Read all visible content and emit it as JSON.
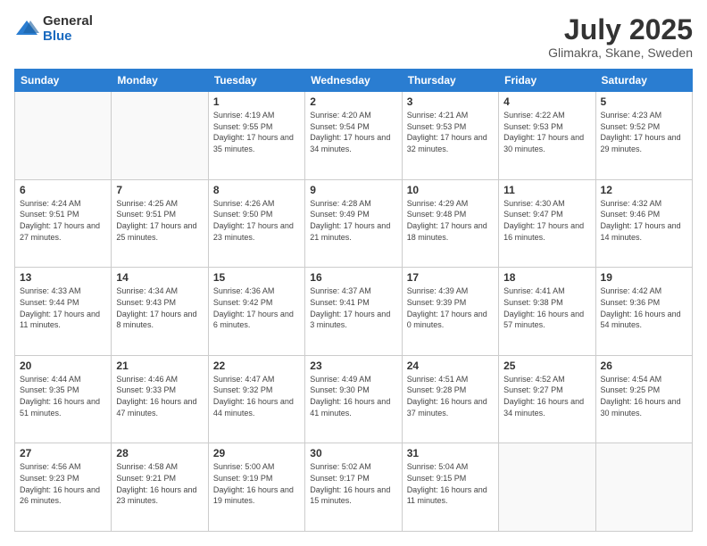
{
  "logo": {
    "general": "General",
    "blue": "Blue"
  },
  "header": {
    "month_year": "July 2025",
    "location": "Glimakra, Skane, Sweden"
  },
  "days_of_week": [
    "Sunday",
    "Monday",
    "Tuesday",
    "Wednesday",
    "Thursday",
    "Friday",
    "Saturday"
  ],
  "weeks": [
    [
      {
        "day": "",
        "info": ""
      },
      {
        "day": "",
        "info": ""
      },
      {
        "day": "1",
        "info": "Sunrise: 4:19 AM\nSunset: 9:55 PM\nDaylight: 17 hours and 35 minutes."
      },
      {
        "day": "2",
        "info": "Sunrise: 4:20 AM\nSunset: 9:54 PM\nDaylight: 17 hours and 34 minutes."
      },
      {
        "day": "3",
        "info": "Sunrise: 4:21 AM\nSunset: 9:53 PM\nDaylight: 17 hours and 32 minutes."
      },
      {
        "day": "4",
        "info": "Sunrise: 4:22 AM\nSunset: 9:53 PM\nDaylight: 17 hours and 30 minutes."
      },
      {
        "day": "5",
        "info": "Sunrise: 4:23 AM\nSunset: 9:52 PM\nDaylight: 17 hours and 29 minutes."
      }
    ],
    [
      {
        "day": "6",
        "info": "Sunrise: 4:24 AM\nSunset: 9:51 PM\nDaylight: 17 hours and 27 minutes."
      },
      {
        "day": "7",
        "info": "Sunrise: 4:25 AM\nSunset: 9:51 PM\nDaylight: 17 hours and 25 minutes."
      },
      {
        "day": "8",
        "info": "Sunrise: 4:26 AM\nSunset: 9:50 PM\nDaylight: 17 hours and 23 minutes."
      },
      {
        "day": "9",
        "info": "Sunrise: 4:28 AM\nSunset: 9:49 PM\nDaylight: 17 hours and 21 minutes."
      },
      {
        "day": "10",
        "info": "Sunrise: 4:29 AM\nSunset: 9:48 PM\nDaylight: 17 hours and 18 minutes."
      },
      {
        "day": "11",
        "info": "Sunrise: 4:30 AM\nSunset: 9:47 PM\nDaylight: 17 hours and 16 minutes."
      },
      {
        "day": "12",
        "info": "Sunrise: 4:32 AM\nSunset: 9:46 PM\nDaylight: 17 hours and 14 minutes."
      }
    ],
    [
      {
        "day": "13",
        "info": "Sunrise: 4:33 AM\nSunset: 9:44 PM\nDaylight: 17 hours and 11 minutes."
      },
      {
        "day": "14",
        "info": "Sunrise: 4:34 AM\nSunset: 9:43 PM\nDaylight: 17 hours and 8 minutes."
      },
      {
        "day": "15",
        "info": "Sunrise: 4:36 AM\nSunset: 9:42 PM\nDaylight: 17 hours and 6 minutes."
      },
      {
        "day": "16",
        "info": "Sunrise: 4:37 AM\nSunset: 9:41 PM\nDaylight: 17 hours and 3 minutes."
      },
      {
        "day": "17",
        "info": "Sunrise: 4:39 AM\nSunset: 9:39 PM\nDaylight: 17 hours and 0 minutes."
      },
      {
        "day": "18",
        "info": "Sunrise: 4:41 AM\nSunset: 9:38 PM\nDaylight: 16 hours and 57 minutes."
      },
      {
        "day": "19",
        "info": "Sunrise: 4:42 AM\nSunset: 9:36 PM\nDaylight: 16 hours and 54 minutes."
      }
    ],
    [
      {
        "day": "20",
        "info": "Sunrise: 4:44 AM\nSunset: 9:35 PM\nDaylight: 16 hours and 51 minutes."
      },
      {
        "day": "21",
        "info": "Sunrise: 4:46 AM\nSunset: 9:33 PM\nDaylight: 16 hours and 47 minutes."
      },
      {
        "day": "22",
        "info": "Sunrise: 4:47 AM\nSunset: 9:32 PM\nDaylight: 16 hours and 44 minutes."
      },
      {
        "day": "23",
        "info": "Sunrise: 4:49 AM\nSunset: 9:30 PM\nDaylight: 16 hours and 41 minutes."
      },
      {
        "day": "24",
        "info": "Sunrise: 4:51 AM\nSunset: 9:28 PM\nDaylight: 16 hours and 37 minutes."
      },
      {
        "day": "25",
        "info": "Sunrise: 4:52 AM\nSunset: 9:27 PM\nDaylight: 16 hours and 34 minutes."
      },
      {
        "day": "26",
        "info": "Sunrise: 4:54 AM\nSunset: 9:25 PM\nDaylight: 16 hours and 30 minutes."
      }
    ],
    [
      {
        "day": "27",
        "info": "Sunrise: 4:56 AM\nSunset: 9:23 PM\nDaylight: 16 hours and 26 minutes."
      },
      {
        "day": "28",
        "info": "Sunrise: 4:58 AM\nSunset: 9:21 PM\nDaylight: 16 hours and 23 minutes."
      },
      {
        "day": "29",
        "info": "Sunrise: 5:00 AM\nSunset: 9:19 PM\nDaylight: 16 hours and 19 minutes."
      },
      {
        "day": "30",
        "info": "Sunrise: 5:02 AM\nSunset: 9:17 PM\nDaylight: 16 hours and 15 minutes."
      },
      {
        "day": "31",
        "info": "Sunrise: 5:04 AM\nSunset: 9:15 PM\nDaylight: 16 hours and 11 minutes."
      },
      {
        "day": "",
        "info": ""
      },
      {
        "day": "",
        "info": ""
      }
    ]
  ]
}
